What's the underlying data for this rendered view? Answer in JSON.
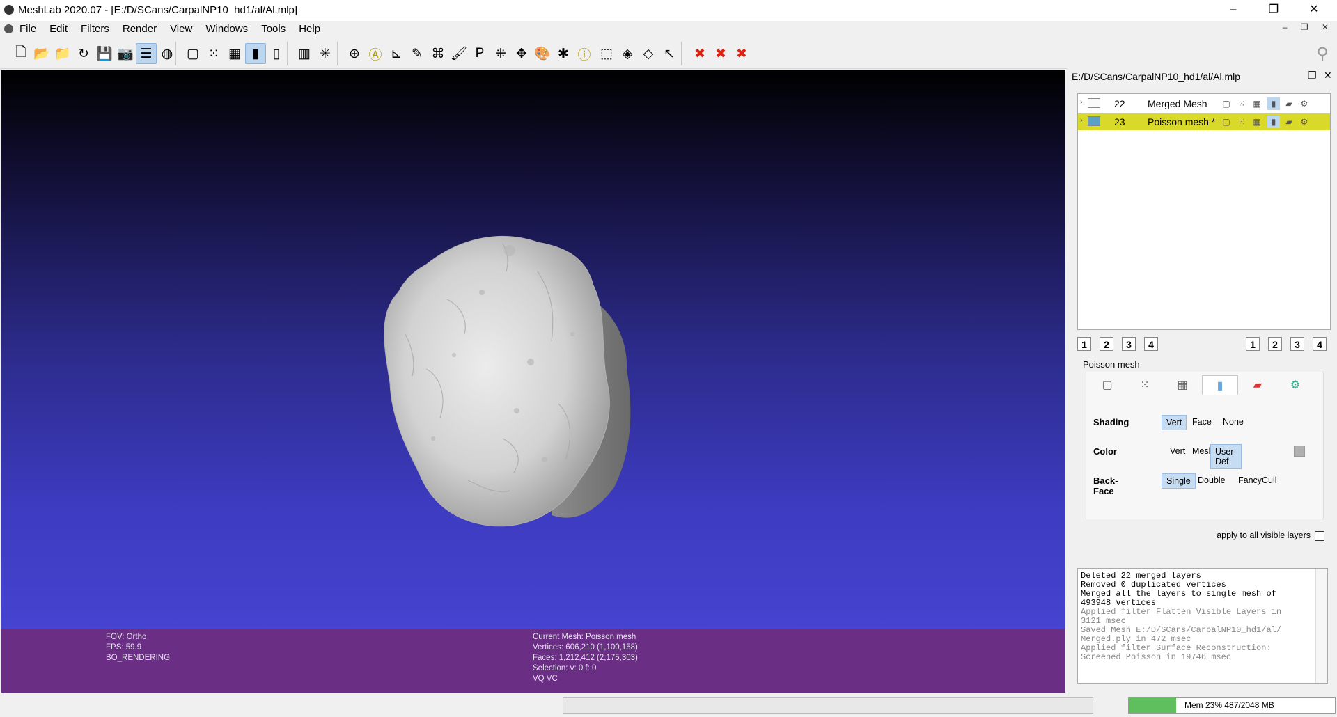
{
  "window": {
    "title": "MeshLab 2020.07 - [E:/D/SCans/CarpalNP10_hd1/al/Al.mlp]",
    "minimize": "–",
    "maximize": "❐",
    "close": "✕"
  },
  "menu": {
    "items": [
      "File",
      "Edit",
      "Filters",
      "Render",
      "View",
      "Windows",
      "Tools",
      "Help"
    ],
    "mdi_controls": "– ❐ ✕"
  },
  "toolbar": {
    "icons": [
      {
        "name": "new-project-icon",
        "glyph": "🗋"
      },
      {
        "name": "open-project-icon",
        "glyph": "📂"
      },
      {
        "name": "import-mesh-icon",
        "glyph": "📁"
      },
      {
        "name": "reload-icon",
        "glyph": "↻"
      },
      {
        "name": "export-mesh-icon",
        "glyph": "💾"
      },
      {
        "name": "snapshot-icon",
        "glyph": "📷"
      },
      {
        "name": "layers-icon",
        "glyph": "☰",
        "active": true
      },
      {
        "name": "raster-icon",
        "glyph": "◍"
      },
      {
        "name": "bbox-icon",
        "glyph": "▢"
      },
      {
        "name": "points-icon",
        "glyph": "⁙"
      },
      {
        "name": "wireframe-icon",
        "glyph": "▦"
      },
      {
        "name": "flat-lines-icon",
        "glyph": "▮",
        "active": true
      },
      {
        "name": "smooth-icon",
        "glyph": "▯"
      },
      {
        "name": "texture-icon",
        "glyph": "▥"
      },
      {
        "name": "axis-icon",
        "glyph": "✳"
      },
      {
        "name": "trackball-icon",
        "glyph": "⊕"
      },
      {
        "name": "label-icon",
        "glyph": "Ⓐ"
      },
      {
        "name": "measure-icon",
        "glyph": "⊾"
      },
      {
        "name": "paint-icon",
        "glyph": "✎"
      },
      {
        "name": "align-icon",
        "glyph": "⌘"
      },
      {
        "name": "brush-icon",
        "glyph": "🖌"
      },
      {
        "name": "pickpoints-icon",
        "glyph": "P"
      },
      {
        "name": "select-vertices-icon",
        "glyph": "⁜"
      },
      {
        "name": "manipulator-icon",
        "glyph": "✥"
      },
      {
        "name": "paint-color-icon",
        "glyph": "🎨"
      },
      {
        "name": "georef-icon",
        "glyph": "✱"
      },
      {
        "name": "info-icon",
        "glyph": "ⓘ"
      },
      {
        "name": "select-faces-icon",
        "glyph": "⬚"
      },
      {
        "name": "select-connected-icon",
        "glyph": "◈"
      },
      {
        "name": "select-z-icon",
        "glyph": "◇"
      },
      {
        "name": "select-pointer-icon",
        "glyph": "↖"
      },
      {
        "name": "delete-vertices-icon",
        "glyph": "✖"
      },
      {
        "name": "delete-faces-icon",
        "glyph": "✖"
      },
      {
        "name": "delete-all-icon",
        "glyph": "✖"
      }
    ],
    "search_icon": "⚲"
  },
  "viewport": {
    "info_left": [
      "FOV: Ortho",
      "FPS:    59.9",
      "BO_RENDERING"
    ],
    "info_mid": [
      "Current Mesh: Poisson mesh",
      "Vertices: 606,210    (1,100,158)",
      "Faces: 1,212,412    (2,175,303)",
      "Selection: v: 0 f: 0",
      "VQ VC"
    ]
  },
  "layer_panel": {
    "path": "E:/D/SCans/CarpalNP10_hd1/al/Al.mlp",
    "layers": [
      {
        "num": "22",
        "name": "Merged Mesh",
        "selected": false
      },
      {
        "num": "23",
        "name": "Poisson mesh *",
        "selected": true
      }
    ],
    "left_buttons": [
      "1",
      "2",
      "3",
      "4"
    ],
    "right_buttons": [
      "1",
      "2",
      "3",
      "4"
    ]
  },
  "render_panel": {
    "mesh_name": "Poisson mesh",
    "shading": {
      "label": "Shading",
      "options": [
        "Vert",
        "Face",
        "None"
      ],
      "selected": "Vert"
    },
    "color": {
      "label": "Color",
      "options": [
        "Vert",
        "Mesh",
        "User-Def"
      ],
      "selected": "User-Def"
    },
    "backface": {
      "label": "Back-Face",
      "options": [
        "Single",
        "Double",
        "Fancy",
        "Cull"
      ],
      "selected": "Single"
    },
    "apply_all": "apply to all visible layers"
  },
  "log": {
    "lines": [
      {
        "text": "Deleted 22 merged layers",
        "muted": false
      },
      {
        "text": "Removed 0 duplicated vertices",
        "muted": false
      },
      {
        "text": "Merged all the layers to single mesh of",
        "muted": false
      },
      {
        "text": "493948 vertices",
        "muted": false
      },
      {
        "text": "Applied filter Flatten Visible Layers in",
        "muted": true
      },
      {
        "text": "3121 msec",
        "muted": true
      },
      {
        "text": "Saved Mesh E:/D/SCans/CarpalNP10_hd1/al/",
        "muted": true
      },
      {
        "text": "Merged.ply in 472 msec",
        "muted": true
      },
      {
        "text": "Applied filter Surface Reconstruction:",
        "muted": true
      },
      {
        "text": "Screened Poisson in 19746 msec",
        "muted": true
      }
    ]
  },
  "status": {
    "memory": "Mem 23% 487/2048 MB",
    "memory_fraction": 0.23
  },
  "colors": {
    "selected_layer": "#d9d92a",
    "info_bar": "#6a2f84"
  }
}
